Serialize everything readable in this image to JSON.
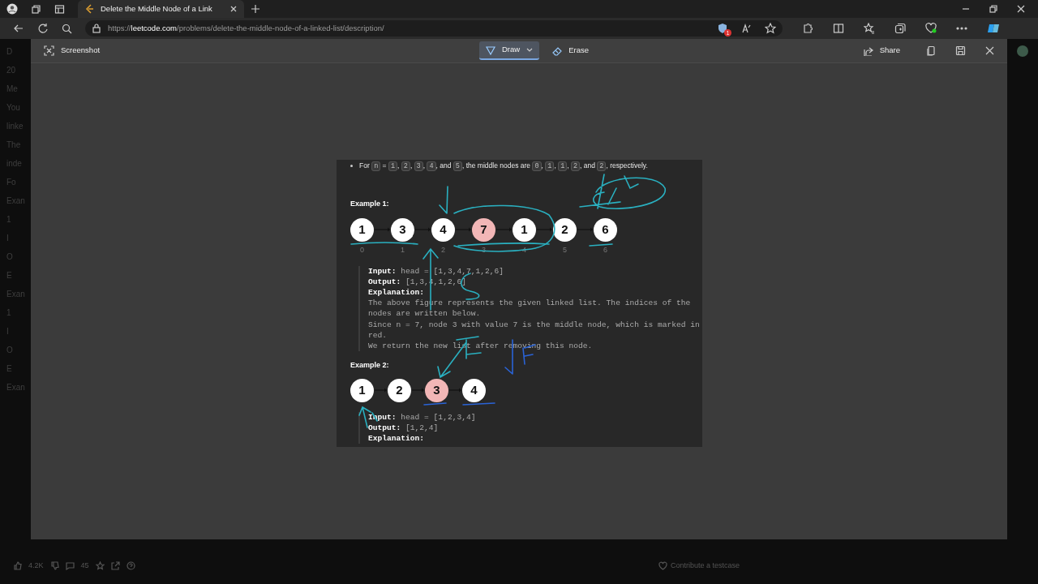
{
  "browser": {
    "tabs": [
      {
        "title": "Delete the Middle Node of a Link",
        "selected": true
      }
    ],
    "url": {
      "scheme": "https://",
      "host": "leetcode.com",
      "path": "/problems/delete-the-middle-node-of-a-linked-list/description/"
    },
    "tracker_badge": "1"
  },
  "screenshot_toolbar": {
    "title": "Screenshot",
    "tools": [
      {
        "label": "Draw",
        "selected": true
      },
      {
        "label": "Erase",
        "selected": false
      }
    ],
    "share": "Share"
  },
  "capture": {
    "bullet": [
      {
        "kind": "text",
        "text": "For "
      },
      {
        "kind": "code",
        "text": "n"
      },
      {
        "kind": "text",
        "text": " = "
      },
      {
        "kind": "code",
        "text": "1"
      },
      {
        "kind": "text",
        "text": ", "
      },
      {
        "kind": "code",
        "text": "2"
      },
      {
        "kind": "text",
        "text": ", "
      },
      {
        "kind": "code",
        "text": "3"
      },
      {
        "kind": "text",
        "text": ", "
      },
      {
        "kind": "code",
        "text": "4"
      },
      {
        "kind": "text",
        "text": ", and "
      },
      {
        "kind": "code",
        "text": "5"
      },
      {
        "kind": "text",
        "text": ", the middle nodes are "
      },
      {
        "kind": "code",
        "text": "0"
      },
      {
        "kind": "text",
        "text": ", "
      },
      {
        "kind": "code",
        "text": "1"
      },
      {
        "kind": "text",
        "text": ", "
      },
      {
        "kind": "code",
        "text": "1"
      },
      {
        "kind": "text",
        "text": ", "
      },
      {
        "kind": "code",
        "text": "2"
      },
      {
        "kind": "text",
        "text": ", and "
      },
      {
        "kind": "code",
        "text": "2"
      },
      {
        "kind": "text",
        "text": ", respectively."
      }
    ],
    "examples": [
      {
        "title": "Example 1:",
        "nodes": [
          {
            "value": "1",
            "index": "0",
            "highlighted": false
          },
          {
            "value": "3",
            "index": "1",
            "highlighted": false
          },
          {
            "value": "4",
            "index": "2",
            "highlighted": false
          },
          {
            "value": "7",
            "index": "3",
            "highlighted": true
          },
          {
            "value": "1",
            "index": "4",
            "highlighted": false
          },
          {
            "value": "2",
            "index": "5",
            "highlighted": false
          },
          {
            "value": "6",
            "index": "6",
            "highlighted": false
          }
        ],
        "lines": [
          {
            "label": "Input:",
            "text": "head = [1,3,4,7,1,2,6]"
          },
          {
            "label": "Output:",
            "text": "[1,3,4,1,2,6]"
          },
          {
            "label": "Explanation:"
          },
          {
            "text": "The above figure represents the given linked list. The indices of the nodes are written below."
          },
          {
            "text": "Since n = 7, node 3 with value 7 is the middle node, which is marked in red."
          },
          {
            "text": "We return the new list after removing this node."
          }
        ]
      },
      {
        "title": "Example 2:",
        "nodes": [
          {
            "value": "1",
            "highlighted": false
          },
          {
            "value": "2",
            "highlighted": false
          },
          {
            "value": "3",
            "highlighted": true
          },
          {
            "value": "4",
            "highlighted": false
          }
        ],
        "lines": [
          {
            "label": "Input:",
            "text": "head = [1,2,3,4]"
          },
          {
            "label": "Output:",
            "text": "[1,2,4]"
          },
          {
            "label": "Explanation:"
          }
        ]
      }
    ]
  },
  "background_page": {
    "fragments": [
      "D",
      "20",
      "Me",
      "You",
      "linke",
      "The",
      "inde",
      "Fo",
      "Exan",
      "1",
      "I",
      "O",
      "E",
      "Exan",
      "1",
      "I",
      "O",
      "E",
      "Exan"
    ],
    "likes": "4.2K",
    "comments": "45",
    "contribute": "Contribute a testcase"
  }
}
